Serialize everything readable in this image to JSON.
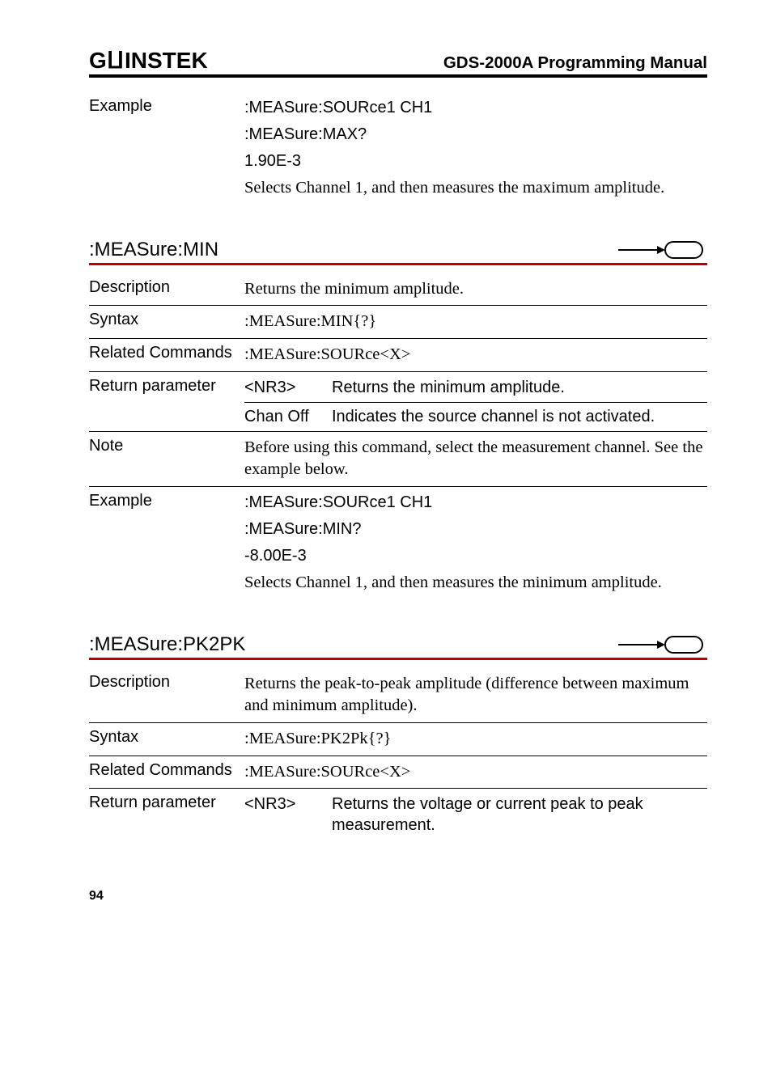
{
  "header": {
    "brand": "GWINSTEK",
    "doc_title": "GDS-2000A Programming Manual"
  },
  "top_example": {
    "label": "Example",
    "line1": ":MEASure:SOURce1 CH1",
    "line2": ":MEASure:MAX?",
    "line3": "1.90E-3",
    "desc": "Selects Channel 1, and then measures the maximum amplitude."
  },
  "measure_min": {
    "title": ":MEASure:MIN",
    "description_label": "Description",
    "description": "Returns the minimum amplitude.",
    "syntax_label": "Syntax",
    "syntax": ":MEASure:MIN{?}",
    "related_label": "Related Commands",
    "related": ":MEASure:SOURce<X>",
    "return_label": "Return parameter",
    "return_rows": [
      {
        "p": "<NR3>",
        "d": "Returns the minimum amplitude."
      },
      {
        "p": "Chan Off",
        "d": "Indicates the source channel is not activated."
      }
    ],
    "note_label": "Note",
    "note": "Before using this command, select the measurement channel. See the example below.",
    "example_label": "Example",
    "example_line1": ":MEASure:SOURce1 CH1",
    "example_line2": ":MEASure:MIN?",
    "example_line3": "-8.00E-3",
    "example_desc": "Selects Channel 1, and then measures the minimum amplitude."
  },
  "measure_pk2pk": {
    "title": ":MEASure:PK2PK",
    "description_label": "Description",
    "description": "Returns the peak-to-peak amplitude (difference between maximum and minimum amplitude).",
    "syntax_label": "Syntax",
    "syntax": ":MEASure:PK2Pk{?}",
    "related_label": "Related Commands",
    "related": ":MEASure:SOURce<X>",
    "return_label": "Return parameter",
    "return_p": "<NR3>",
    "return_d": "Returns the voltage or current peak to peak measurement."
  },
  "page_number": "94"
}
